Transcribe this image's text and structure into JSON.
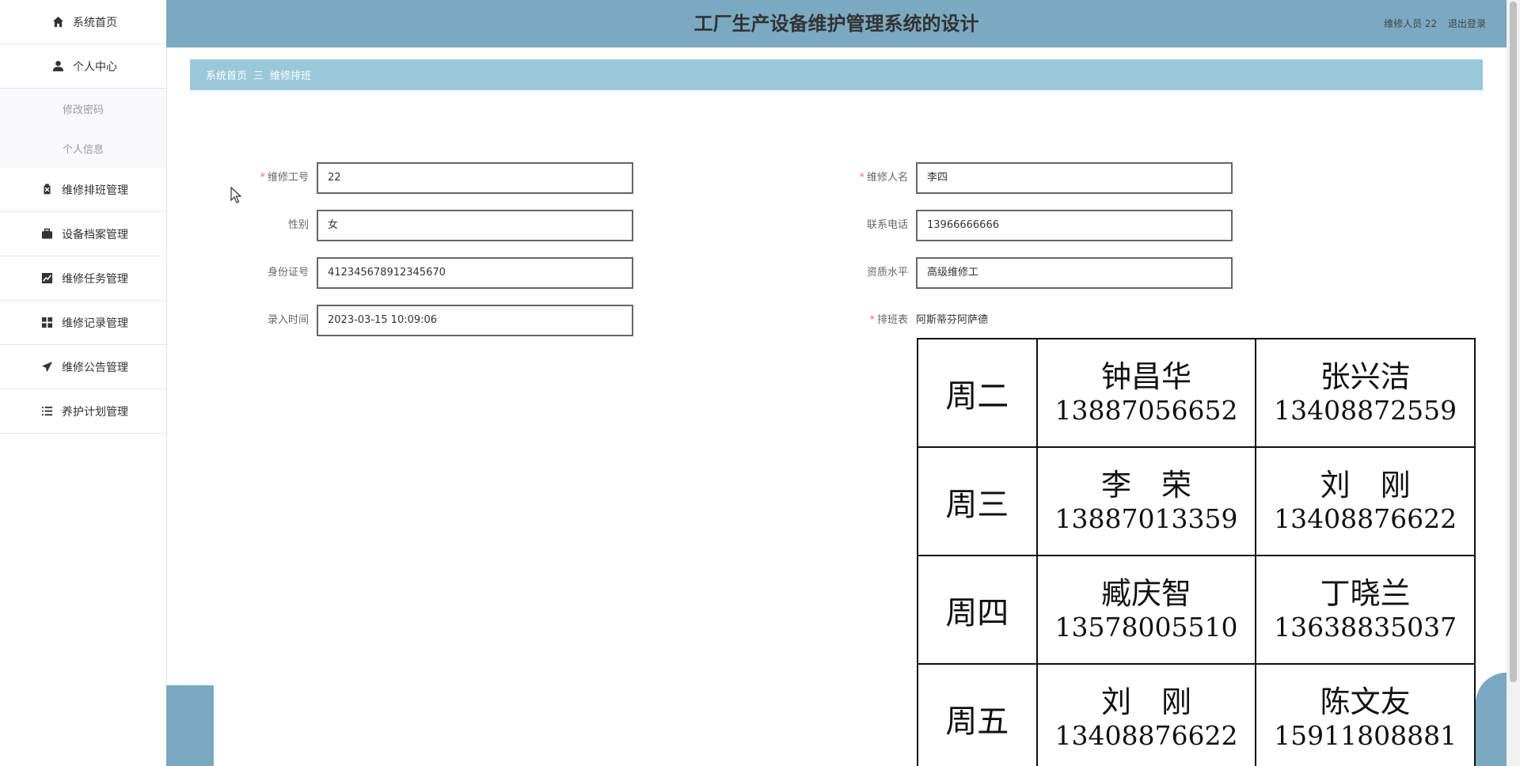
{
  "sidebar": {
    "items": [
      {
        "label": "系统首页",
        "icon": "home-icon"
      },
      {
        "label": "个人中心",
        "icon": "user-icon"
      },
      {
        "label": "维修排班管理",
        "icon": "clipboard-icon"
      },
      {
        "label": "设备档案管理",
        "icon": "briefcase-icon"
      },
      {
        "label": "维修任务管理",
        "icon": "chart-icon"
      },
      {
        "label": "维修记录管理",
        "icon": "grid-icon"
      },
      {
        "label": "维修公告管理",
        "icon": "send-icon"
      },
      {
        "label": "养护计划管理",
        "icon": "list-icon"
      }
    ],
    "submenu": [
      "修改密码",
      "个人信息"
    ]
  },
  "header": {
    "title": "工厂生产设备维护管理系统的设计",
    "user": "维修人员 22",
    "logout": "退出登录"
  },
  "breadcrumb": {
    "home": "系统首页",
    "separator": "三",
    "current": "维修排班"
  },
  "form": {
    "worker_no": {
      "label": "维修工号",
      "value": "22"
    },
    "worker_name": {
      "label": "维修人名",
      "value": "李四"
    },
    "gender": {
      "label": "性别",
      "value": "女"
    },
    "phone": {
      "label": "联系电话",
      "value": "13966666666"
    },
    "id_card": {
      "label": "身份证号",
      "value": "412345678912345670"
    },
    "qualification": {
      "label": "资质水平",
      "value": "高级维修工"
    },
    "entry_time": {
      "label": "录入时间",
      "value": "2023-03-15 10:09:06"
    },
    "schedule": {
      "label": "排班表",
      "file": "阿斯蒂芬阿萨德"
    }
  },
  "schedule_table": {
    "rows": [
      {
        "day": "周二",
        "a_name": "钟昌华",
        "a_phone": "13887056652",
        "b_name": "张兴洁",
        "b_phone": "13408872559"
      },
      {
        "day": "周三",
        "a_name": "李　荣",
        "a_phone": "13887013359",
        "b_name": "刘　刚",
        "b_phone": "13408876622"
      },
      {
        "day": "周四",
        "a_name": "臧庆智",
        "a_phone": "13578005510",
        "b_name": "丁晓兰",
        "b_phone": "13638835037"
      },
      {
        "day": "周五",
        "a_name": "刘　刚",
        "a_phone": "13408876622",
        "b_name": "陈文友",
        "b_phone": "15911808881"
      }
    ]
  },
  "colors": {
    "header_bg": "#7aa9c1",
    "breadcrumb_bg": "#9ac8d8",
    "required": "#f56c6c"
  }
}
